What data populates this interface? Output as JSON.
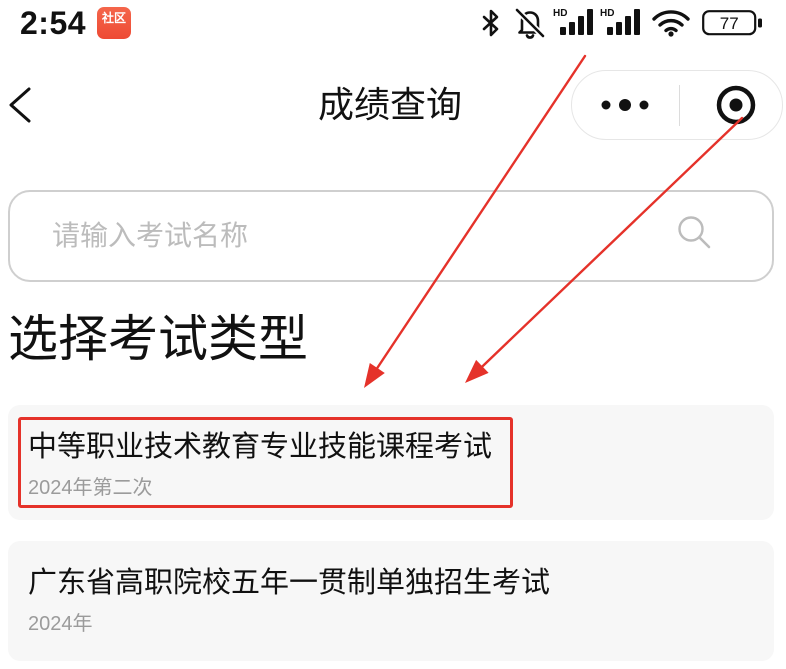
{
  "status_bar": {
    "time": "2:54",
    "app_icon_label": "社区",
    "signal_1_label": "HD",
    "signal_2_label": "HD",
    "battery_level": "77"
  },
  "nav_bar": {
    "title": "成绩查询"
  },
  "search": {
    "placeholder": "请输入考试名称",
    "value": ""
  },
  "section_title": "选择考试类型",
  "exam_types": [
    {
      "name": "中等职业技术教育专业技能课程考试",
      "session": "2024年第二次",
      "highlighted": true
    },
    {
      "name": "广东省高职院校五年一贯制单独招生考试",
      "session": "2024年",
      "highlighted": false
    }
  ],
  "icons": {
    "status": [
      "bluetooth-icon",
      "muted-bell-icon",
      "signal-hd-icon",
      "signal-hd-icon",
      "wifi-icon",
      "battery-icon"
    ],
    "back": "chevron-left-icon",
    "capsule_menu": "more-dots-icon",
    "capsule_close": "target-circle-icon",
    "search": "search-icon"
  },
  "colors": {
    "text": "#111111",
    "subtext": "#9b9b9b",
    "placeholder": "#bcbcbc",
    "border": "#cfcfcf",
    "card_bg": "#f7f7f7",
    "annotation_red": "#e5322a",
    "app_icon_red": "#ee4a34"
  }
}
